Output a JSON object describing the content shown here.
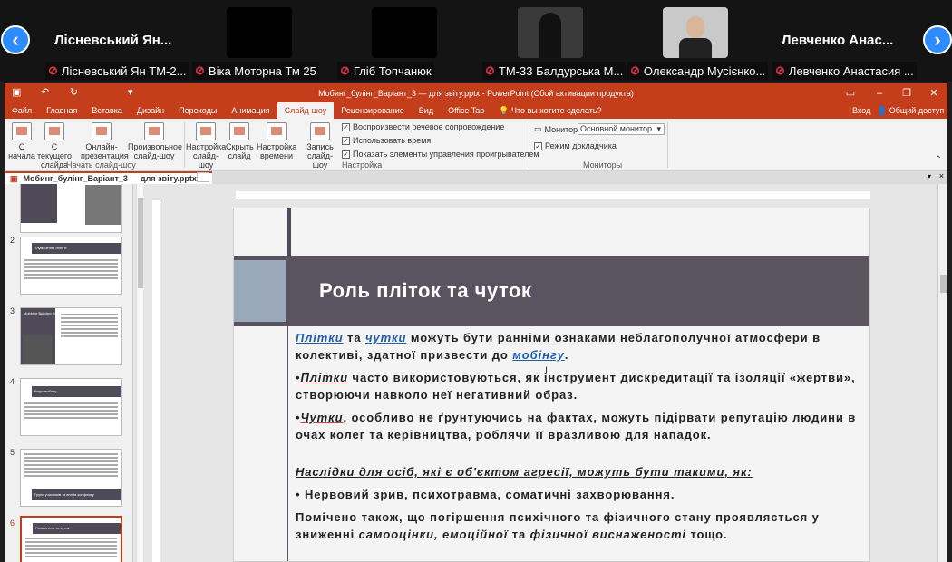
{
  "zoom": {
    "tiles": [
      {
        "big_name": "Лісневський Ян...",
        "label": "Лісневський Ян ТМ-2..."
      },
      {
        "big_name": "",
        "label": "Віка Моторна Тм 25"
      },
      {
        "big_name": "",
        "label": "Гліб Топчанюк"
      },
      {
        "big_name": "",
        "label": "ТМ-33 Балдурська М..."
      },
      {
        "big_name": "",
        "label": "Олександр Мусієнко..."
      },
      {
        "big_name": "Левченко Анас...",
        "label": "Левченко Анастасия ..."
      }
    ],
    "prev_arrow": "‹",
    "next_arrow": "›"
  },
  "window": {
    "title": "Мобинг_булінг_Варіант_3 — для звіту.pptx - PowerPoint (Сбой активации продукта)",
    "minimize": "–",
    "restore": "❐",
    "close": "✕"
  },
  "tabs": [
    "Файл",
    "Главная",
    "Вставка",
    "Дизайн",
    "Переходы",
    "Анимация",
    "Слайд-шоу",
    "Рецензирование",
    "Вид",
    "Office Tab"
  ],
  "active_tab": "Слайд-шоу",
  "tell_me": "Что вы хотите сделать?",
  "signin": "Вход",
  "share": "Общий доступ",
  "ribbon": {
    "buttons": {
      "from_start": "С начала",
      "from_current": "С текущего слайда",
      "online": "Онлайн-презентация",
      "custom": "Произвольное слайд-шоу",
      "setup": "Настройка слайд-шоу",
      "hide": "Скрыть слайд",
      "rehearse": "Настройка времени",
      "record": "Запись слайд-шоу"
    },
    "checks": {
      "narration": "Воспроизвести речевое сопровождение",
      "timings": "Использовать время",
      "media_controls": "Показать элементы управления проигрывателем",
      "presenter_view": "Режим докладчика"
    },
    "monitor_label": "Монитор:",
    "monitor_value": "Основной монитор",
    "groups": {
      "start": "Начать слайд-шоу",
      "setup": "Настройка",
      "monitors": "Мониторы"
    }
  },
  "doc_tab": "Мобинг_булінг_Варіант_3 — для звіту.pptx",
  "thumbnails": [
    {
      "num": "2",
      "title": "Тлумачення понятт"
    },
    {
      "num": "3",
      "title": "Mobbing  Bullying  Bossing"
    },
    {
      "num": "4",
      "title": "Види мобінгу"
    },
    {
      "num": "5",
      "title": "Групи учасників та вплив конфлікту"
    },
    {
      "num": "6",
      "title": "Роль пліток та чуток"
    }
  ],
  "slide": {
    "title": "Роль пліток та чуток",
    "p1_w1": "Плітки",
    "p1_t1": " та ",
    "p1_w2": "чутки",
    "p1_t2": " можуть бути ранніми ознаками неблагополучної атмосфери в колективі, здатної призвести до ",
    "p1_w3": "мобінгу",
    "p1_t3": ".",
    "p2_bullet": "•",
    "p2_w1": "Плітки",
    "p2_t1": " часто використовуються, як інструмент дискредитації та ізоляції «жертви», створюючи навколо неї негативний образ.",
    "p3_bullet": "•",
    "p3_w1": "Чутки",
    "p3_t1": ", особливо не ґрунтуючись на фактах, можуть підірвати репутацію людини в очах колег та керівництва, роблячи її вразливою для нападок.",
    "p4": "Наслідки для осіб, які є об'єктом агресії, можуть бути такими, як:",
    "p5": "• Нервовий зрив, психотравма, соматичні захворювання.",
    "p6_t1": "Помічено також, що погіршення психічного та фізичного стану проявляється у зниженні ",
    "p6_i1": "самооцінки, емоційної",
    "p6_t2": " та ",
    "p6_i2": "фізичної виснаженості",
    "p6_t3": " тощо."
  }
}
